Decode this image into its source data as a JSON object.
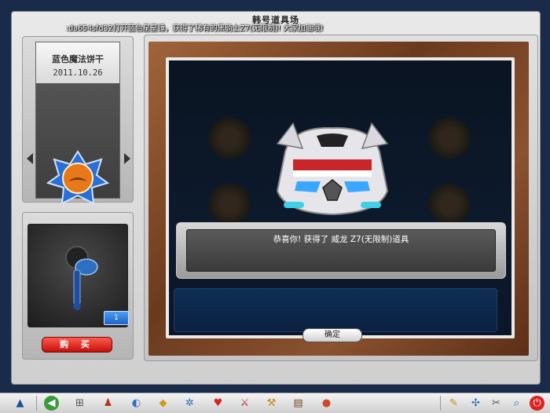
{
  "window": {
    "title": "韩号道具场"
  },
  "broadcast": {
    "text": ":da654sfd32打开蓝色星星锤，获得了稀有的黑骑士Z7(无限制)! 大家加油哦!"
  },
  "item_card": {
    "name": "蓝色魔法饼干",
    "date": "2011.10.26"
  },
  "preview": {
    "count": "1",
    "buy_label": "购 买"
  },
  "result": {
    "message": "恭喜你! 获得了 威龙 Z7(无限制)道具",
    "confirm_label": "确定"
  },
  "colors": {
    "accent_red": "#c3100a",
    "badge_blue": "#1f63c9",
    "wood": "#7a4524",
    "stage": "#0b1628"
  },
  "taskbar": {
    "icons": [
      "logo-icon",
      "back-icon",
      "shop-cart-icon",
      "character-icon",
      "ring-icon",
      "box-icon",
      "gear-icon",
      "heart-icon",
      "sword-icon",
      "hammer-icon",
      "book-icon",
      "cookie-icon",
      "note-icon",
      "network-icon",
      "tools-icon",
      "magnifier-icon",
      "power-icon"
    ]
  }
}
